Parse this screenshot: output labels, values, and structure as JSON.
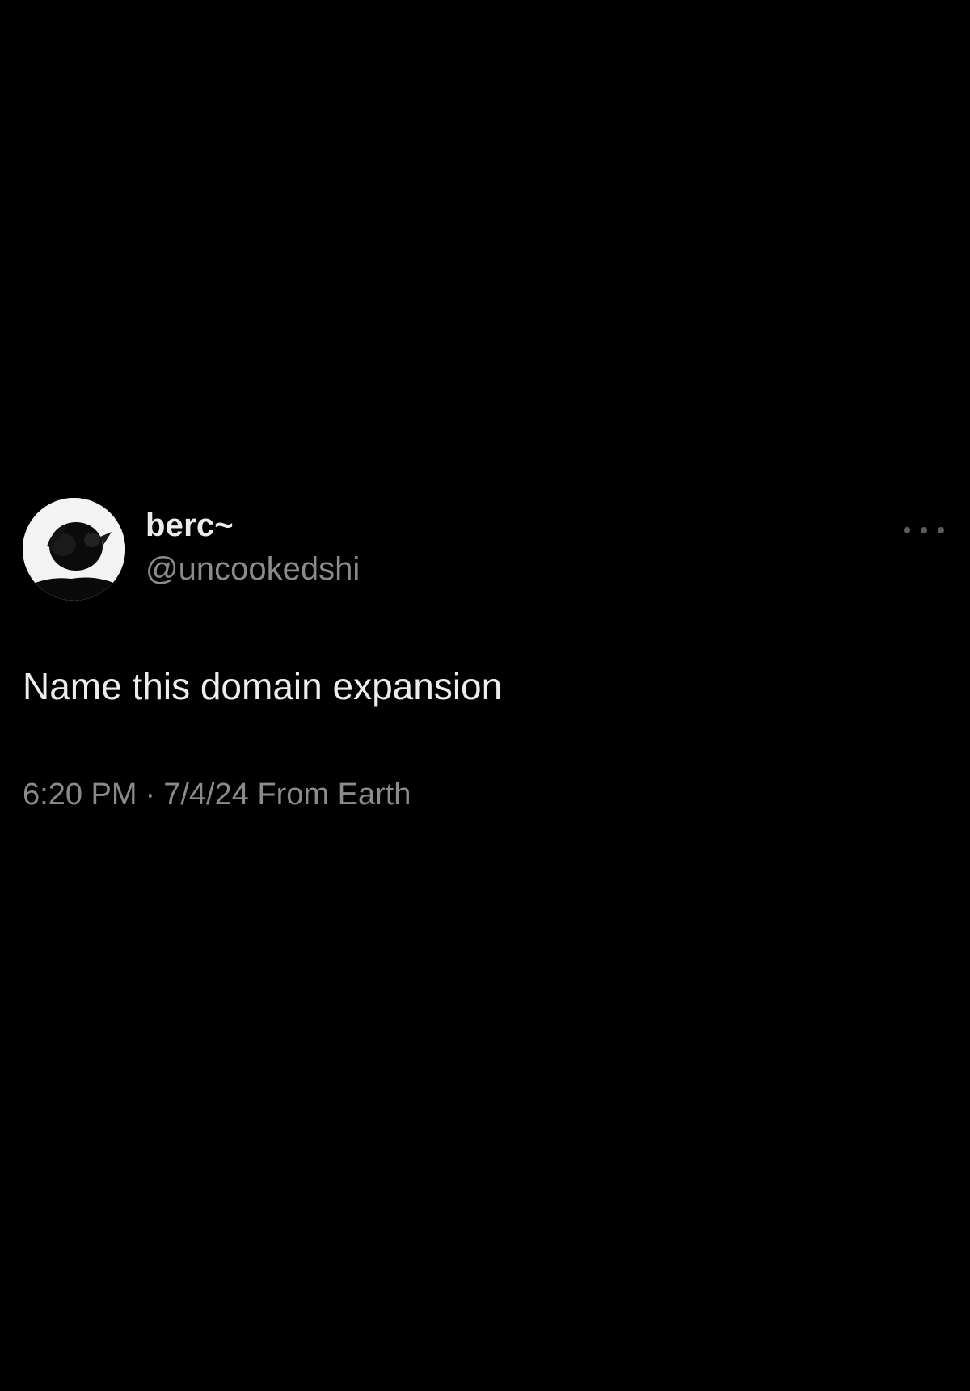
{
  "tweet": {
    "display_name": "berc~",
    "handle": "@uncookedshi",
    "text": "Name this domain expansion",
    "time": "6:20 PM",
    "separator": "·",
    "date": "7/4/24",
    "source": "From Earth"
  },
  "icons": {
    "avatar": "profile-avatar",
    "more": "more-options-icon"
  },
  "colors": {
    "background": "#000000",
    "primary_text": "#ececec",
    "secondary_text": "#8b8b8b"
  }
}
